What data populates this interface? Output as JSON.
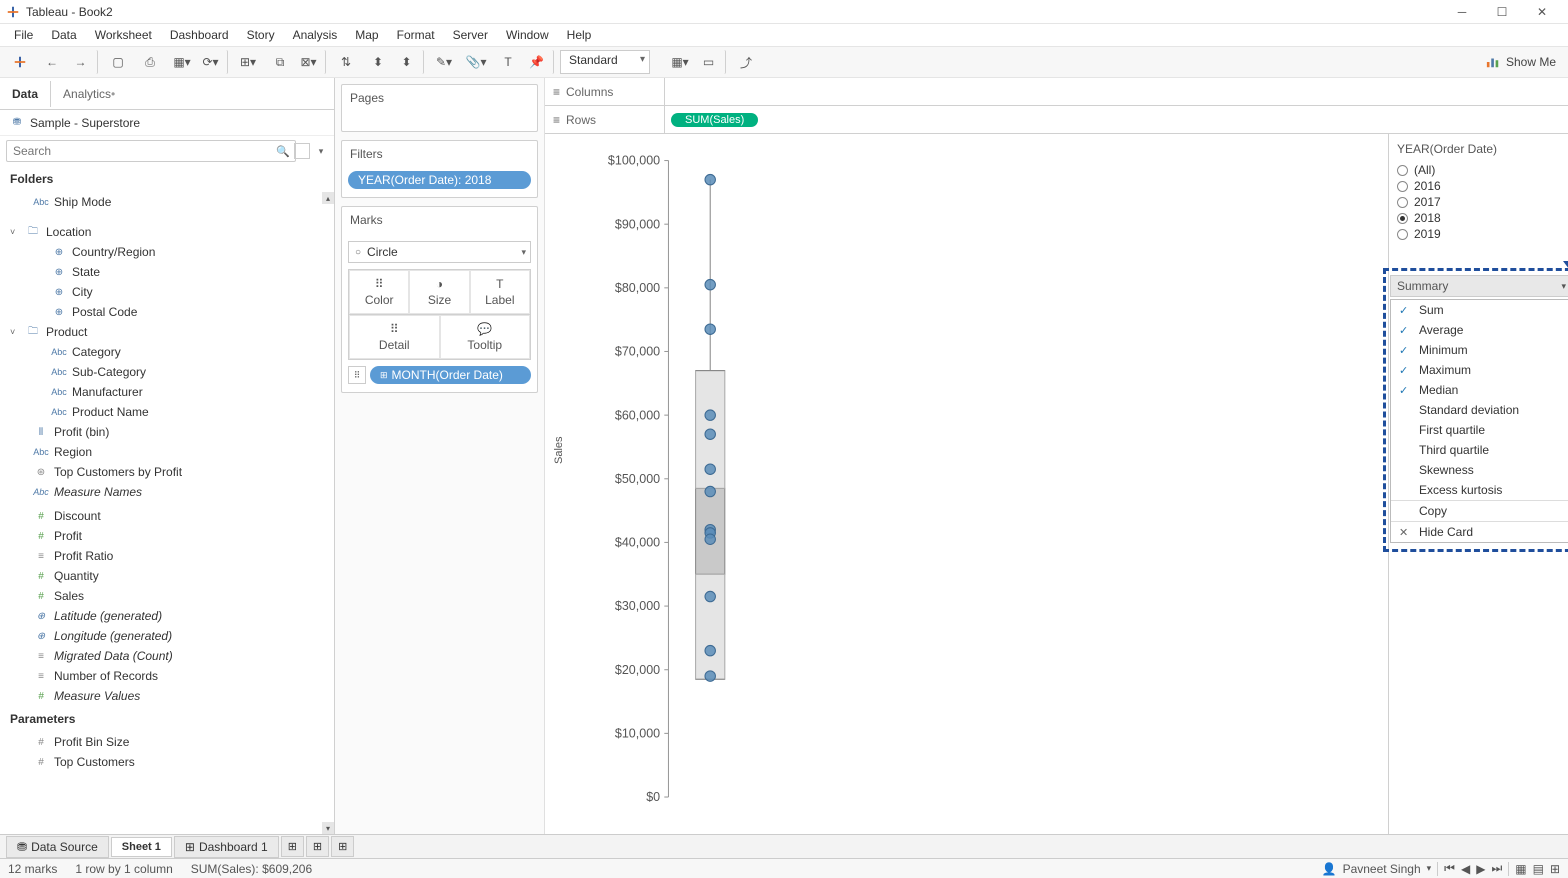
{
  "window": {
    "title": "Tableau - Book2"
  },
  "menus": [
    "File",
    "Data",
    "Worksheet",
    "Dashboard",
    "Story",
    "Analysis",
    "Map",
    "Format",
    "Server",
    "Window",
    "Help"
  ],
  "toolbar": {
    "fit": "Standard",
    "showme": "Show Me"
  },
  "datapane": {
    "tabs": {
      "data": "Data",
      "analytics": "Analytics"
    },
    "datasource": "Sample - Superstore",
    "search_placeholder": "Search",
    "folders_header": "Folders",
    "fields": {
      "ship_mode": "Ship Mode",
      "location": "Location",
      "country": "Country/Region",
      "state": "State",
      "city": "City",
      "postal": "Postal Code",
      "product": "Product",
      "category": "Category",
      "subcat": "Sub-Category",
      "manufacturer": "Manufacturer",
      "product_name": "Product Name",
      "profit_bin": "Profit (bin)",
      "region": "Region",
      "top_customers": "Top Customers by Profit",
      "measure_names": "Measure Names",
      "discount": "Discount",
      "profit": "Profit",
      "profit_ratio": "Profit Ratio",
      "quantity": "Quantity",
      "sales": "Sales",
      "latitude": "Latitude (generated)",
      "longitude": "Longitude (generated)",
      "migrated": "Migrated Data (Count)",
      "num_records": "Number of Records",
      "measure_values": "Measure Values"
    },
    "parameters_header": "Parameters",
    "params": {
      "profit_bin_size": "Profit Bin Size",
      "top_customers_p": "Top Customers"
    }
  },
  "shelves": {
    "pages": "Pages",
    "filters": "Filters",
    "filter_pill": "YEAR(Order Date): 2018",
    "marks": "Marks",
    "mark_type": "Circle",
    "mark_cells": {
      "color": "Color",
      "size": "Size",
      "label": "Label",
      "detail": "Detail",
      "tooltip": "Tooltip"
    },
    "detail_pill": "MONTH(Order Date)",
    "columns_label": "Columns",
    "rows_label": "Rows",
    "rows_pill": "SUM(Sales)"
  },
  "chart_data": {
    "type": "scatter",
    "ylabel": "Sales",
    "ylim": [
      0,
      100000
    ],
    "yticks": [
      0,
      10000,
      20000,
      30000,
      40000,
      50000,
      60000,
      70000,
      80000,
      90000,
      100000
    ],
    "ytick_labels": [
      "$0",
      "$10,000",
      "$20,000",
      "$30,000",
      "$40,000",
      "$50,000",
      "$60,000",
      "$70,000",
      "$80,000",
      "$90,000",
      "$100,000"
    ],
    "box": {
      "q1": 35000,
      "q3": 48500,
      "whisker_low": 18500,
      "whisker_high": 67000
    },
    "points": [
      97000,
      80500,
      73500,
      60000,
      57000,
      51500,
      48000,
      42000,
      41500,
      40500,
      31500,
      23000,
      19000
    ]
  },
  "filter_card": {
    "title": "YEAR(Order Date)",
    "options": [
      "(All)",
      "2016",
      "2017",
      "2018",
      "2019"
    ],
    "selected": "2018"
  },
  "summary_menu": {
    "header": "Summary",
    "items": [
      {
        "label": "Sum",
        "checked": true
      },
      {
        "label": "Average",
        "checked": true
      },
      {
        "label": "Minimum",
        "checked": true
      },
      {
        "label": "Maximum",
        "checked": true
      },
      {
        "label": "Median",
        "checked": true
      },
      {
        "label": "Standard deviation",
        "checked": false
      },
      {
        "label": "First quartile",
        "checked": false
      },
      {
        "label": "Third quartile",
        "checked": false
      },
      {
        "label": "Skewness",
        "checked": false
      },
      {
        "label": "Excess kurtosis",
        "checked": false
      }
    ],
    "copy": "Copy",
    "hide": "Hide Card"
  },
  "bottom": {
    "datasource": "Data Source",
    "sheet1": "Sheet 1",
    "dashboard1": "Dashboard 1"
  },
  "status": {
    "marks": "12 marks",
    "rowcol": "1 row by 1 column",
    "sum": "SUM(Sales): $609,206",
    "user": "Pavneet Singh"
  }
}
